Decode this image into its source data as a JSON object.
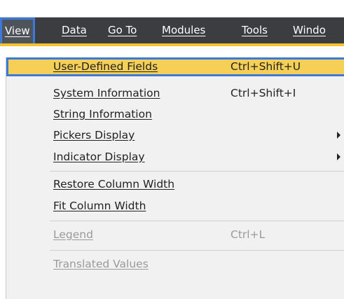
{
  "menubar": {
    "items": [
      "View",
      "Data",
      "Go To",
      "Modules",
      "Tools",
      "Windo"
    ]
  },
  "dropdown": {
    "items": [
      {
        "label": "User-Defined Fields",
        "shortcut": "Ctrl+Shift+U"
      },
      {
        "label": "System Information",
        "shortcut": "Ctrl+Shift+I"
      },
      {
        "label": "String Information",
        "shortcut": ""
      },
      {
        "label": "Pickers Display",
        "shortcut": ""
      },
      {
        "label": "Indicator Display",
        "shortcut": ""
      },
      {
        "label": "Restore Column Width",
        "shortcut": ""
      },
      {
        "label": "Fit Column Width",
        "shortcut": ""
      },
      {
        "label": "Legend",
        "shortcut": "Ctrl+L"
      },
      {
        "label": "Translated Values",
        "shortcut": ""
      }
    ]
  },
  "colors": {
    "menubar": "#3b3d41",
    "accent": "#f4c430",
    "highlight": "#f6cf57",
    "focus_border": "#3b7ad8",
    "disabled_text": "#9a9a9a"
  }
}
